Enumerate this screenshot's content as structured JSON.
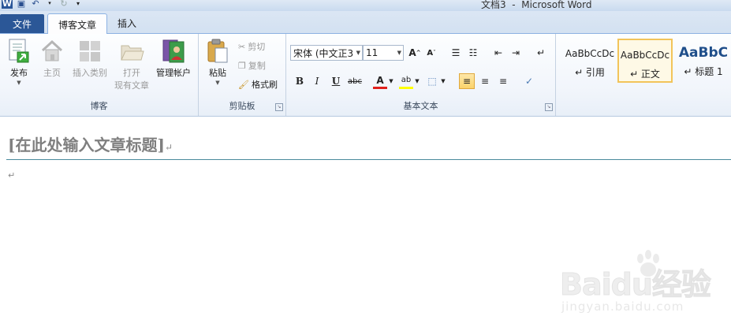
{
  "window": {
    "title": "文档3  -  Microsoft Word"
  },
  "tabs": {
    "file": "文件",
    "blog": "博客文章",
    "insert": "插入"
  },
  "groups": {
    "blog": {
      "label": "博客",
      "publish": "发布",
      "home": "主页",
      "insert_category": "插入类别",
      "open_line1": "打开",
      "open_line2": "现有文章",
      "manage_accounts": "管理帐户"
    },
    "clipboard": {
      "label": "剪贴板",
      "paste": "粘贴",
      "cut": "剪切",
      "copy": "复制",
      "format_painter": "格式刷"
    },
    "basic_text": {
      "label": "基本文本",
      "font_name": "宋体 (中文正3",
      "font_size": "11",
      "bold": "B",
      "italic": "I",
      "underline": "U",
      "strike": "abc"
    },
    "styles": {
      "items": [
        {
          "sample": "AaBbCcDc",
          "name": "↵ 引用"
        },
        {
          "sample": "AaBbCcDc",
          "name": "↵ 正文"
        },
        {
          "sample": "AaBbC",
          "name": "↵ 标题 1"
        }
      ]
    }
  },
  "document": {
    "title_placeholder": "[在此处输入文章标题]",
    "paragraph_mark": "↵"
  },
  "watermark": {
    "brand": "Baidu经验",
    "url": "jingyan.baidu.com"
  },
  "colors": {
    "file_tab": "#2b5797",
    "selected_style_border": "#f2c45a",
    "title_rule": "#4a8a9c",
    "font_color_red": "#e0201c",
    "highlight_yellow": "#ffff00"
  }
}
